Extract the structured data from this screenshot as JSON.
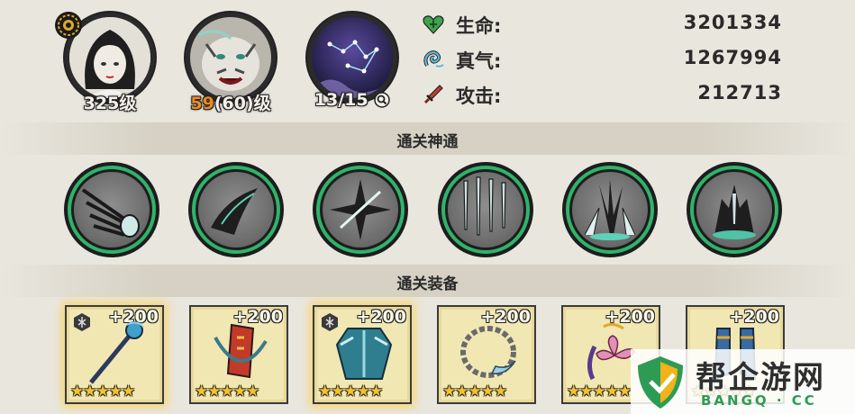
{
  "heroes": [
    {
      "name": "player-portrait",
      "level": "325级"
    },
    {
      "name": "pet-portrait",
      "level_current": "59",
      "level_rest": "(60)级"
    },
    {
      "name": "constellation-portrait",
      "progress": "13/15",
      "progress_value": 0.867
    }
  ],
  "stats": [
    {
      "label": "生命:",
      "value": "3201334",
      "icon": "heart-plus-icon",
      "color": "#3fa34d"
    },
    {
      "label": "真气:",
      "value": "1267994",
      "icon": "qi-swirl-icon",
      "color": "#3f9bb8"
    },
    {
      "label": "攻击:",
      "value": "212713",
      "icon": "sword-icon",
      "color": "#c2412e"
    }
  ],
  "sections": {
    "skills_title": "通关神通",
    "equipment_title": "通关装备"
  },
  "skills": [
    {
      "icon": "claw-slash-skill-icon"
    },
    {
      "icon": "wing-blade-skill-icon"
    },
    {
      "icon": "star-burst-skill-icon"
    },
    {
      "icon": "falling-swords-skill-icon"
    },
    {
      "icon": "spike-burst-skill-icon"
    },
    {
      "icon": "sword-tomb-skill-icon"
    }
  ],
  "equipment": [
    {
      "icon": "staff-item-icon",
      "plus": "+200",
      "stars": "★★★★★",
      "rating": 5,
      "highlighted": true
    },
    {
      "icon": "bow-scroll-item-icon",
      "plus": "+200",
      "stars": "★★★★★",
      "rating": 5,
      "highlighted": false
    },
    {
      "icon": "armor-item-icon",
      "plus": "+200",
      "stars": "★★★★★",
      "rating": 5,
      "highlighted": true
    },
    {
      "icon": "bead-necklace-item-icon",
      "plus": "+200",
      "stars": "★★★★★",
      "rating": 5,
      "highlighted": false
    },
    {
      "icon": "lotus-pendant-item-icon",
      "plus": "+200",
      "stars": "★★★★★",
      "rating": 5,
      "highlighted": false
    },
    {
      "icon": "boots-item-icon",
      "plus": "+200",
      "stars": "★★★★★",
      "rating": 5,
      "highlighted": false
    }
  ],
  "watermark": {
    "brand": "帮企游网",
    "domain": "BANGQ · CC"
  },
  "colors": {
    "accent_green": "#2fb36b",
    "level_orange": "#f08a1e",
    "star_gold": "#f5c22a"
  }
}
